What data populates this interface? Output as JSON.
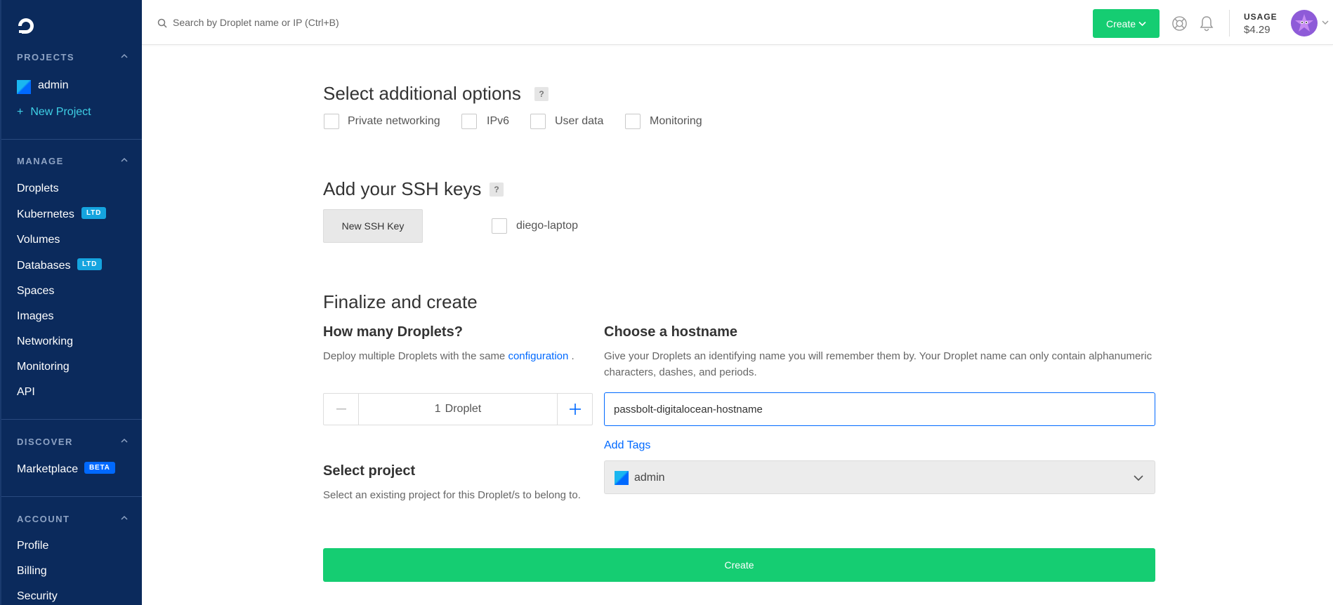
{
  "sidebar": {
    "logo_icon": "digitalocean-logo-icon",
    "projects": {
      "heading": "PROJECTS",
      "items": [
        {
          "label": "admin",
          "icon": "project-icon"
        }
      ],
      "new_project": "New Project"
    },
    "manage": {
      "heading": "MANAGE",
      "items": [
        {
          "label": "Droplets"
        },
        {
          "label": "Kubernetes",
          "badge": "LTD"
        },
        {
          "label": "Volumes"
        },
        {
          "label": "Databases",
          "badge": "LTD"
        },
        {
          "label": "Spaces"
        },
        {
          "label": "Images"
        },
        {
          "label": "Networking"
        },
        {
          "label": "Monitoring"
        },
        {
          "label": "API"
        }
      ]
    },
    "discover": {
      "heading": "DISCOVER",
      "items": [
        {
          "label": "Marketplace",
          "badge": "BETA"
        }
      ]
    },
    "account": {
      "heading": "ACCOUNT",
      "items": [
        {
          "label": "Profile"
        },
        {
          "label": "Billing"
        },
        {
          "label": "Security"
        }
      ]
    }
  },
  "topbar": {
    "search_placeholder": "Search by Droplet name or IP (Ctrl+B)",
    "create_label": "Create",
    "usage_label": "USAGE",
    "usage_value": "$4.29"
  },
  "main": {
    "additional_options": {
      "title": "Select additional options",
      "help": "?",
      "options": [
        {
          "label": "Private networking",
          "checked": false
        },
        {
          "label": "IPv6",
          "checked": false
        },
        {
          "label": "User data",
          "checked": false
        },
        {
          "label": "Monitoring",
          "checked": false
        }
      ]
    },
    "ssh_keys": {
      "title": "Add your SSH keys",
      "help": "?",
      "new_key_button": "New SSH Key",
      "keys": [
        {
          "label": "diego-laptop",
          "checked": false
        }
      ]
    },
    "finalize": {
      "title": "Finalize and create",
      "droplets": {
        "title": "How many Droplets?",
        "description": "Deploy multiple Droplets with the same",
        "link": "configuration",
        "suffix": ".",
        "count": "1",
        "unit": "Droplet"
      },
      "hostname": {
        "title": "Choose a hostname",
        "description": "Give your Droplets an identifying name you will remember them by. Your Droplet name can only contain alphanumeric characters, dashes, and periods.",
        "value": "passbolt-digitalocean-hostname"
      },
      "add_tags": "Add Tags",
      "project": {
        "title": "Select project",
        "description": "Select an existing project for this Droplet/s to belong to.",
        "selected": "admin"
      },
      "create_button": "Create"
    }
  },
  "colors": {
    "sidebar_bg": "#0b2a5c",
    "accent_green": "#15cd72",
    "link_blue": "#0069ff",
    "badge_ltd": "#15a4df"
  }
}
